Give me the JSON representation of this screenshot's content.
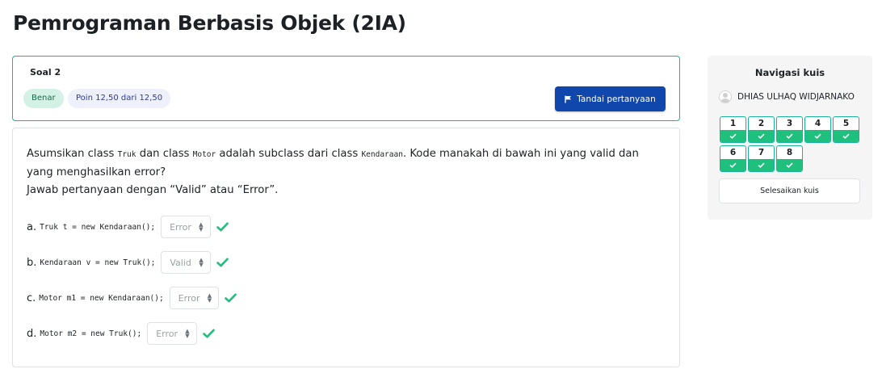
{
  "page": {
    "title": "Pemrograman Berbasis Objek (2IA)"
  },
  "question_info": {
    "number_label": "Soal 2",
    "status_badge": "Benar",
    "points_badge": "Poin 12,50 dari 12,50",
    "flag_button_label": "Tandai pertanyaan"
  },
  "question": {
    "text_part1": "Asumsikan class ",
    "code1": "Truk",
    "text_part2": " dan class ",
    "code2": "Motor",
    "text_part3": " adalah subclass dari class ",
    "code3": "Kendaraan",
    "text_part4": ". Kode manakah di bawah ini yang valid dan yang menghasilkan error?",
    "instruction": "Jawab pertanyaan dengan “Valid” atau “Error”.",
    "answers": [
      {
        "letter": "a.",
        "code": "Truk t = new Kendaraan();",
        "selected": "Error",
        "correct": true
      },
      {
        "letter": "b.",
        "code": "Kendaraan v = new Truk();",
        "selected": "Valid",
        "correct": true
      },
      {
        "letter": "c.",
        "code": "Motor m1 = new Kendaraan();",
        "selected": "Error",
        "correct": true
      },
      {
        "letter": "d.",
        "code": "Motor m2 = new Truk();",
        "selected": "Error",
        "correct": true
      }
    ]
  },
  "quiz_nav": {
    "title": "Navigasi kuis",
    "user_name": "DHIAS ULHAQ WIDJARNAKO",
    "questions": [
      {
        "number": "1",
        "state": "correct"
      },
      {
        "number": "2",
        "state": "correct"
      },
      {
        "number": "3",
        "state": "correct"
      },
      {
        "number": "4",
        "state": "correct"
      },
      {
        "number": "5",
        "state": "correct"
      },
      {
        "number": "6",
        "state": "correct"
      },
      {
        "number": "7",
        "state": "correct"
      },
      {
        "number": "8",
        "state": "correct"
      }
    ],
    "finish_label": "Selesaikan kuis"
  },
  "colors": {
    "accent_teal": "#1bb39a",
    "primary_button": "#0f47ad",
    "correct_green": "#1fbf7d",
    "correct_badge_bg": "#d4f1e6"
  },
  "icons": {
    "flag": "flag-icon",
    "check": "check-icon",
    "select_arrows": "updown-chevron-icon",
    "avatar": "user-avatar-icon"
  }
}
